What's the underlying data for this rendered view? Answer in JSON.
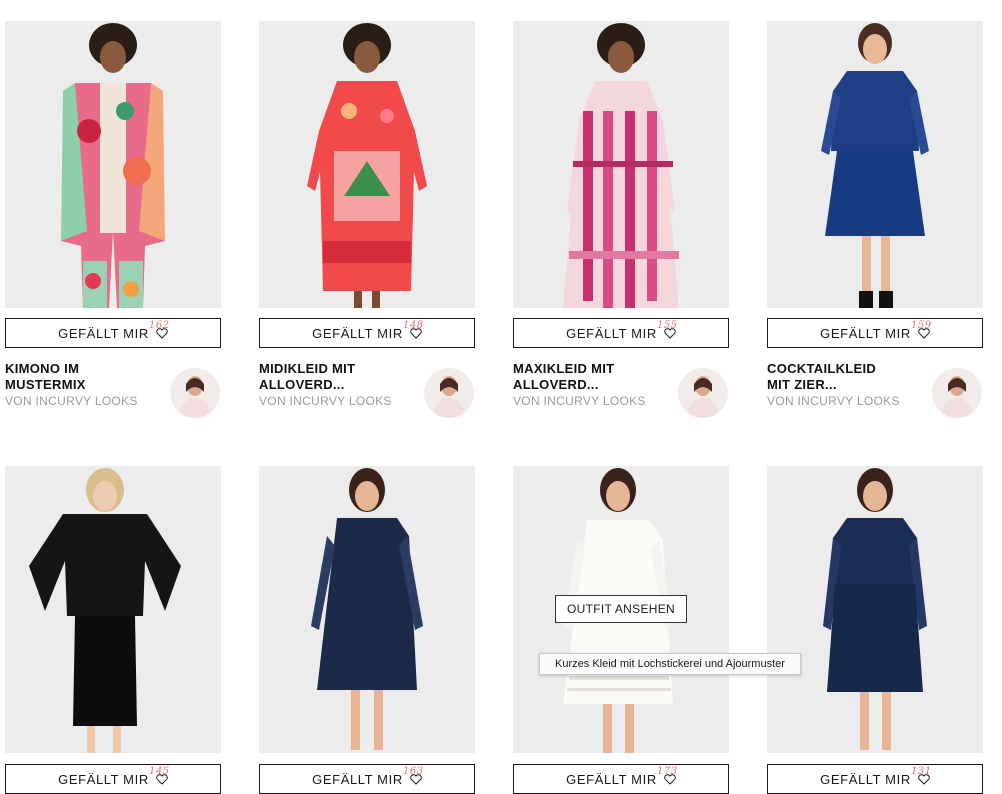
{
  "like_label": "GEFÄLLT MIR",
  "outfit_button": "OUTFIT ANSEHEN",
  "tooltip": "Kurzes Kleid mit Lochstickerei und Ajourmuster",
  "products": [
    {
      "likes": "162",
      "title1": "KIMONO IM",
      "title2": "MUSTERMIX",
      "author": "VON INCURVY LOOKS"
    },
    {
      "likes": "148",
      "title1": "MIDIKLEID MIT",
      "title2": "ALLOVERD...",
      "author": "VON INCURVY LOOKS"
    },
    {
      "likes": "155",
      "title1": "MAXIKLEID MIT",
      "title2": "ALLOVERD...",
      "author": "VON INCURVY LOOKS"
    },
    {
      "likes": "159",
      "title1": "COCKTAILKLEID",
      "title2": "MIT ZIER...",
      "author": "VON INCURVY LOOKS"
    },
    {
      "likes": "145"
    },
    {
      "likes": "163"
    },
    {
      "likes": "173"
    },
    {
      "likes": "131"
    }
  ]
}
